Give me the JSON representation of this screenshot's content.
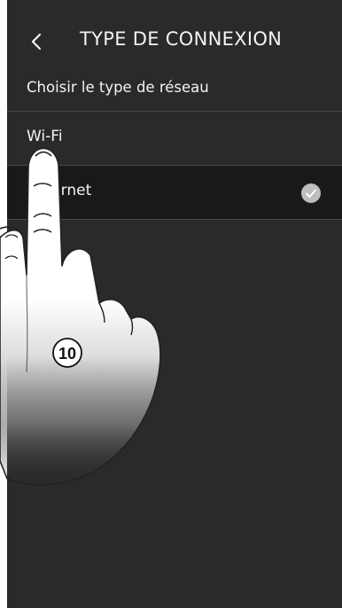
{
  "header": {
    "back_glyph": "<",
    "title": "TYPE DE CONNEXION"
  },
  "subtitle": "Choisir le type de réseau",
  "options": [
    {
      "label": "Wi-Fi",
      "selected": false
    },
    {
      "label": "Ethernet",
      "selected": true
    }
  ],
  "step_marker": "10",
  "colors": {
    "background": "#2b2a2a",
    "selected_row": "#1a1919",
    "text": "#f3f3f3",
    "check": "#bdbdbd"
  }
}
